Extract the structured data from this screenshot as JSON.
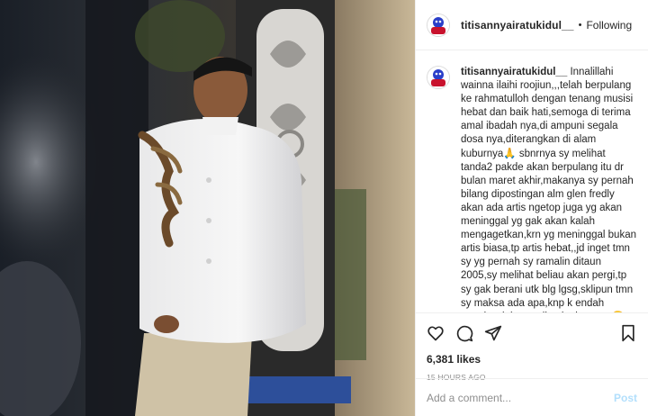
{
  "header": {
    "username": "titisannyairatukidul__",
    "separator": "•",
    "follow_status": "Following",
    "avatar_icon": "profile-avatar-icon"
  },
  "caption": {
    "username": "titisannyairatukidul__",
    "text": "Innalillahi wainna ilaihi roojiun,,,telah berpulang ke rahmatulloh dengan tenang musisi hebat dan baik hati,semoga di terima amal ibadah nya,di ampuni segala dosa nya,diterangkan di alam kuburnya🙏 sbnrnya sy melihat tanda2 pakde akan berpulang itu dr bulan maret akhir,makanya sy pernah bilang dipostingan alm glen fredly akan ada artis ngetop juga yg akan meninggal yg gak akan kalah mengagetkan,krn yg meninggal bukan artis biasa,tp artis hebat,,jd inget tmn sy yg pernah sy ramalin ditaun 2005,sy melihat beliau akan pergi,tp sy gak berani utk blg lgsg,sklipun tmn sy maksa ada apa,knp k endah nangis stlah ramalin aku katanya😢tp sy gk sggup blg"
  },
  "actions": {
    "like_icon": "heart-icon",
    "comment_icon": "comment-icon",
    "share_icon": "send-icon",
    "save_icon": "bookmark-icon"
  },
  "stats": {
    "likes": "6,381 likes",
    "time_ago": "15 HOURS AGO"
  },
  "comment": {
    "placeholder": "Add a comment...",
    "post_label": "Post"
  },
  "colors": {
    "post_button": "#b2dffc",
    "muted": "#8e8e8e",
    "text": "#262626",
    "divider": "#efefef"
  }
}
